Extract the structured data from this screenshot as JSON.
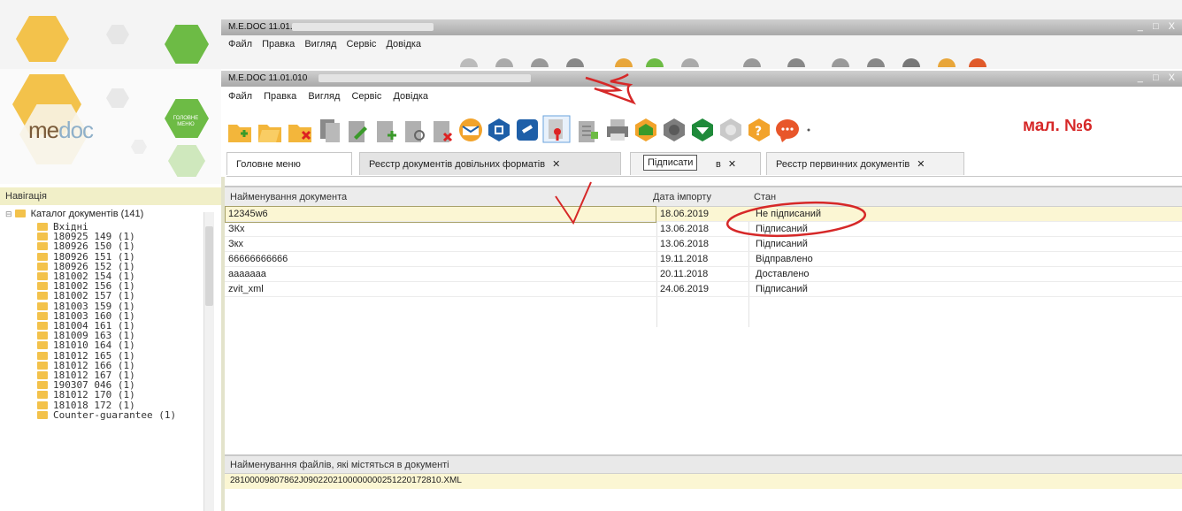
{
  "background_window": {
    "title": "M.E.DOC 11.01.010",
    "menu": [
      "Файл",
      "Правка",
      "Вигляд",
      "Сервіс",
      "Довідка"
    ]
  },
  "window": {
    "title": "M.E.DOC 11.01.010",
    "controls": "_ □ X",
    "menu": [
      "Файл",
      "Правка",
      "Вигляд",
      "Сервіс",
      "Довідка"
    ]
  },
  "logo": {
    "brand_me": "me",
    "brand_doc": "doc",
    "main_menu_label": "ГОЛОВНЕ МЕНЮ"
  },
  "annotation_label": "мал. №6",
  "tooltip": "Підписати",
  "tabs": [
    {
      "label": "Головне меню",
      "closable": false
    },
    {
      "label": "Реєстр документів довільних форматів",
      "closable": true,
      "active": true
    },
    {
      "label": "в",
      "closable": true
    },
    {
      "label": "Реєстр первинних документів",
      "closable": true
    }
  ],
  "tab_close_glyph": "✕",
  "navigation": {
    "header": "Навігація",
    "root": "Каталог документів (141)",
    "items": [
      "Вхідні",
      "180925 149 (1)",
      "180926 150 (1)",
      "180926 151 (1)",
      "180926 152 (1)",
      "181002 154 (1)",
      "181002 156 (1)",
      "181002 157 (1)",
      "181003 159 (1)",
      "181003 160 (1)",
      "181004 161 (1)",
      "181009 163 (1)",
      "181010 164 (1)",
      "181012 165 (1)",
      "181012 166 (1)",
      "181012 167 (1)",
      "190307 046 (1)",
      "181012 170 (1)",
      "181018 172 (1)",
      "Counter-guarantee (1)"
    ]
  },
  "documents_table": {
    "columns": [
      "Найменування документа",
      "Дата імпорту",
      "Стан"
    ],
    "rows": [
      {
        "name": "12345w6",
        "date": "18.06.2019",
        "status": "Не підписаний"
      },
      {
        "name": "ЗКх",
        "date": "13.06.2018",
        "status": "Підписаний"
      },
      {
        "name": "Зкх",
        "date": "13.06.2018",
        "status": "Підписаний"
      },
      {
        "name": "66666666666",
        "date": "19.11.2018",
        "status": "Відправлено"
      },
      {
        "name": "ааааааа",
        "date": "20.11.2018",
        "status": "Доставлено"
      },
      {
        "name": "zvit_xml",
        "date": "24.06.2019",
        "status": "Підписаний"
      }
    ]
  },
  "files_panel": {
    "header": "Найменування файлів, які містяться в документі",
    "rows": [
      "28100009807862J0902202100000000251220172810.XML"
    ]
  },
  "colors": {
    "accent_yellow": "#f3c24b",
    "accent_green": "#6dbb45",
    "annotation_red": "#d62828",
    "selected_row": "#fbf6d3"
  },
  "toolbar_icons": [
    "folder-new-icon",
    "folder-open-icon",
    "folder-delete-icon",
    "copy-icon",
    "edit-icon",
    "add-doc-icon",
    "view-doc-icon",
    "delete-doc-icon",
    "send-envelope-icon",
    "archive-icon",
    "link-icon",
    "sign-icon",
    "sign-list-icon",
    "print-icon",
    "receive-envelope-icon",
    "settings-icon",
    "download-icon",
    "disabled-icon",
    "help-icon",
    "chat-icon"
  ]
}
